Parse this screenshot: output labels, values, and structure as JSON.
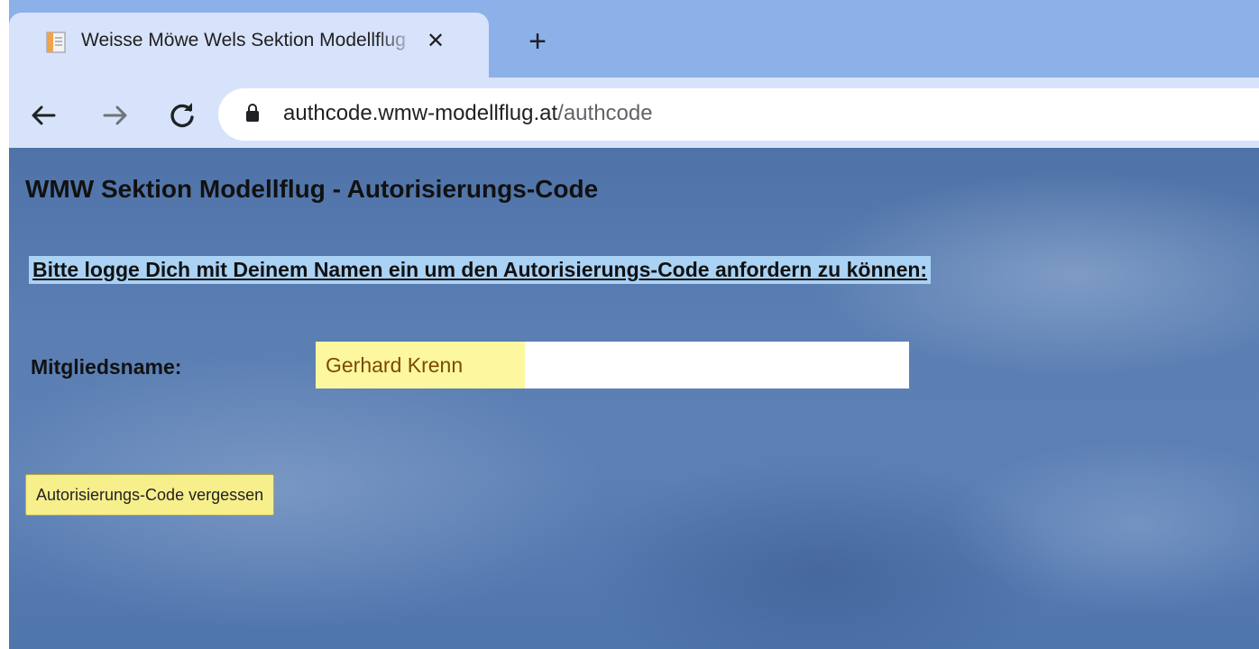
{
  "browser": {
    "tab": {
      "title": "Weisse Möwe Wels Sektion Modellflug",
      "favicon": "document-icon",
      "close_symbol": "✕"
    },
    "new_tab_symbol": "+",
    "address_bar": {
      "host": "authcode.wmw-modellflug.at",
      "path": "/authcode"
    },
    "colors": {
      "tabstrip": "#8cb0e8",
      "toolbar": "#d7e3fb"
    }
  },
  "page": {
    "title": "WMW Sektion Modellflug - Autorisierungs-Code",
    "instruction": "Bitte logge Dich mit Deinem Namen ein um den Autorisierungs-Code anfordern zu können:",
    "member_label": "Mitgliedsname:",
    "member_value": "Gerhard Krenn",
    "forgot_button": "Autorisierungs-Code vergessen",
    "colors": {
      "instruction_highlight": "#a9d2f5",
      "autofill": "#fdf7a0",
      "button_background": "#f7ef8c",
      "background": "#5b7fb3"
    }
  }
}
